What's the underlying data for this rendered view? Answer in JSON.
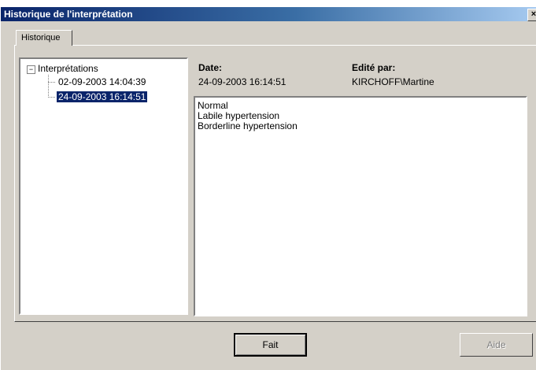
{
  "window": {
    "title": "Historique de l'interprétation",
    "close_glyph": "×"
  },
  "tabs": [
    {
      "label": "Historique",
      "selected": true
    }
  ],
  "tree": {
    "expand_glyph": "−",
    "root": "Interprétations",
    "items": [
      {
        "label": "02-09-2003 14:04:39",
        "selected": false
      },
      {
        "label": "24-09-2003 16:14:51",
        "selected": true
      }
    ]
  },
  "details": {
    "date_label": "Date:",
    "date_value": "24-09-2003 16:14:51",
    "editor_label": "Edité par:",
    "editor_value": "KIRCHOFF\\Martine"
  },
  "notes": {
    "lines": [
      "Normal",
      "Labile hypertension",
      "Borderline hypertension"
    ]
  },
  "buttons": {
    "done": "Fait",
    "help": "Aide",
    "help_enabled": false
  }
}
